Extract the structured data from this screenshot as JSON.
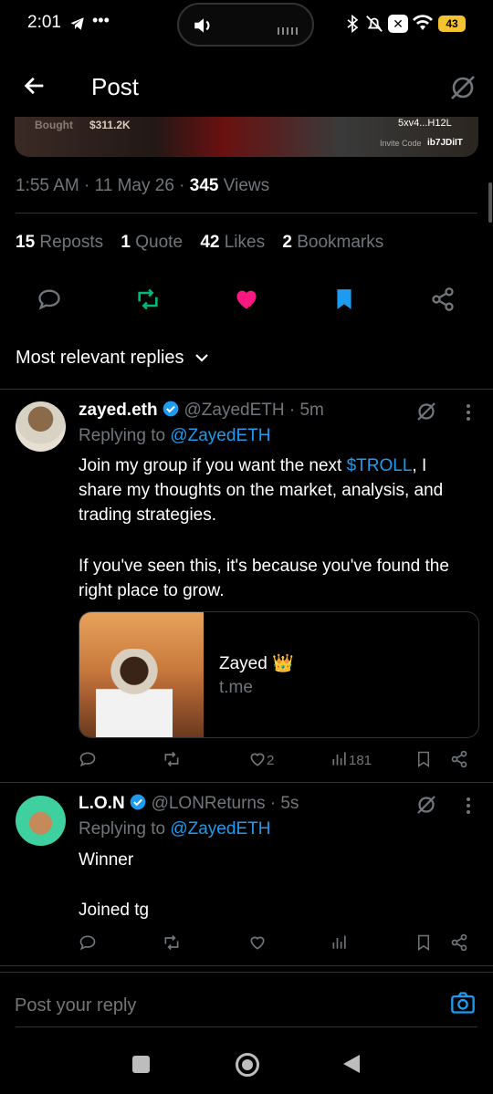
{
  "status_bar": {
    "time": "2:01",
    "battery": "43"
  },
  "header": {
    "title": "Post"
  },
  "media": {
    "bought_label": "Bought",
    "bought_value": "$311.2K",
    "wallet": "5xv4...H12L",
    "invite_label": "Invite Code",
    "invite_code": "ib7JDiIT"
  },
  "post_meta": {
    "timestamp": "1:55 AM · 11 May 26 · ",
    "views_count": "345",
    "views_label": " Views"
  },
  "stats": {
    "reposts_count": "15",
    "reposts_label": "Reposts",
    "quotes_count": "1",
    "quotes_label": "Quote",
    "likes_count": "42",
    "likes_label": "Likes",
    "bookmarks_count": "2",
    "bookmarks_label": "Bookmarks"
  },
  "colors": {
    "repost_active": "#00ba7c",
    "like_active": "#f91880",
    "bookmark_active": "#1d9bf0",
    "link": "#1d9bf0"
  },
  "replies_filter": {
    "label": "Most relevant replies"
  },
  "replies": [
    {
      "name": "zayed.eth",
      "handle": "@ZayedETH · 5m",
      "replying_prefix": "Replying to ",
      "replying_to": "@ZayedETH",
      "text_a": "Join my group if you want the next ",
      "cashtag": "$TROLL",
      "text_b": ", I share my thoughts on the market, analysis, and trading strategies.",
      "text_c": "If you've seen this, it's because you've found the right place to grow.",
      "card_title": "Zayed 👑",
      "card_domain": "t.me",
      "likes": "2",
      "views": "181"
    },
    {
      "name": "L.O.N",
      "handle": "@LONReturns · 5s",
      "replying_prefix": "Replying to ",
      "replying_to": "@ZayedETH",
      "text_a": "Winner",
      "text_b": "Joined tg"
    }
  ],
  "composer": {
    "placeholder": "Post your reply"
  }
}
